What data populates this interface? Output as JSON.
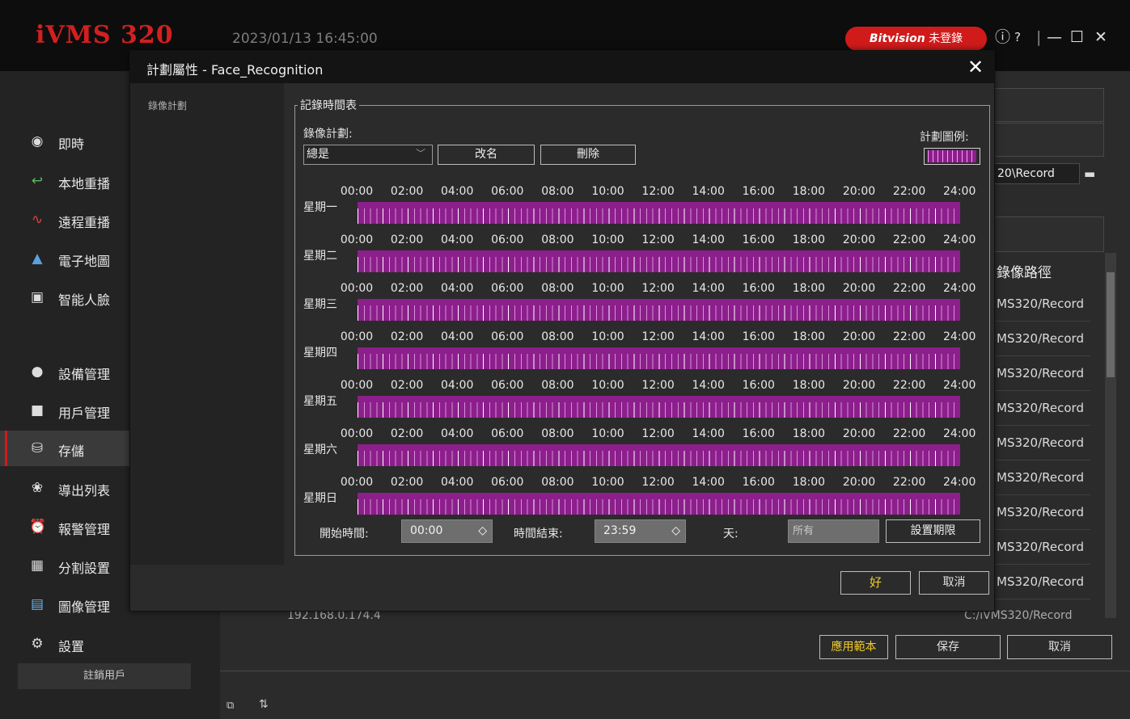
{
  "app": {
    "logo": "iVMS 320",
    "datetime": "2023/01/13 16:45:00",
    "login_brand": "Bitvision",
    "login_status": "未登錄",
    "window_controls": [
      "ⓘ",
      "?",
      "|",
      "—",
      "☐",
      "✕"
    ]
  },
  "sidebar": {
    "items": [
      {
        "label": "即時",
        "icon": "camera-icon"
      },
      {
        "label": "本地重播",
        "icon": "local-playback-icon"
      },
      {
        "label": "遠程重播",
        "icon": "remote-playback-icon"
      },
      {
        "label": "電子地圖",
        "icon": "map-icon"
      },
      {
        "label": "智能人臉",
        "icon": "face-icon"
      },
      {
        "label": "設備管理",
        "icon": "device-icon"
      },
      {
        "label": "用戶管理",
        "icon": "user-icon"
      },
      {
        "label": "存儲",
        "icon": "storage-icon"
      },
      {
        "label": "導出列表",
        "icon": "export-icon"
      },
      {
        "label": "報警管理",
        "icon": "alarm-icon"
      },
      {
        "label": "分割設置",
        "icon": "split-icon"
      },
      {
        "label": "圖像管理",
        "icon": "image-icon"
      },
      {
        "label": "設置",
        "icon": "settings-icon"
      }
    ],
    "active": "存儲",
    "logout": "註銷用戶"
  },
  "background": {
    "path_value": "20\\Record",
    "column_header": "錄像路徑",
    "rows": [
      "MS320/Record",
      "MS320/Record",
      "MS320/Record",
      "MS320/Record",
      "MS320/Record",
      "MS320/Record",
      "MS320/Record",
      "MS320/Record",
      "MS320/Record"
    ],
    "partial_row": "192.168.0.174.4",
    "partial_row_path": "C:/iVMS320/Record",
    "apply_template": "應用範本",
    "save": "保存",
    "cancel": "取消"
  },
  "dialog": {
    "title": "計劃屬性 - Face_Recognition",
    "left_label": "錄像計劃",
    "group_title": "記錄時間表",
    "plan_label": "錄像計劃:",
    "plan_value": "總是",
    "rename": "改名",
    "delete": "刪除",
    "legend_label": "計劃圖例:",
    "legend_color": "#8c1f8c",
    "time_ticks": [
      "00:00",
      "02:00",
      "04:00",
      "06:00",
      "08:00",
      "10:00",
      "12:00",
      "14:00",
      "16:00",
      "18:00",
      "20:00",
      "22:00",
      "24:00"
    ],
    "days": [
      "星期一",
      "星期二",
      "星期三",
      "星期四",
      "星期五",
      "星期六",
      "星期日"
    ],
    "start_label": "開始時間:",
    "start_value": "00:00",
    "end_label": "時間結束:",
    "end_value": "23:59",
    "day_label": "天:",
    "day_value": "所有",
    "set_period": "設置期限",
    "ok": "好",
    "cancel": "取消"
  }
}
